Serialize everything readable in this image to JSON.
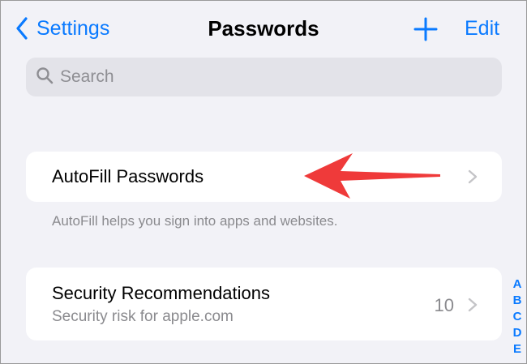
{
  "nav": {
    "back_label": "Settings",
    "title": "Passwords",
    "edit_label": "Edit"
  },
  "search": {
    "placeholder": "Search",
    "value": ""
  },
  "autofill": {
    "label": "AutoFill Passwords",
    "footnote": "AutoFill helps you sign into apps and websites."
  },
  "security": {
    "title": "Security Recommendations",
    "subtitle": "Security risk for apple.com",
    "count": "10"
  },
  "index": [
    "A",
    "B",
    "C",
    "D",
    "E"
  ],
  "colors": {
    "accent": "#0a7aff",
    "background": "#f2f2f7",
    "card": "#ffffff",
    "secondary_text": "#8a8a8e",
    "annotation_arrow": "#ef3a3a"
  }
}
